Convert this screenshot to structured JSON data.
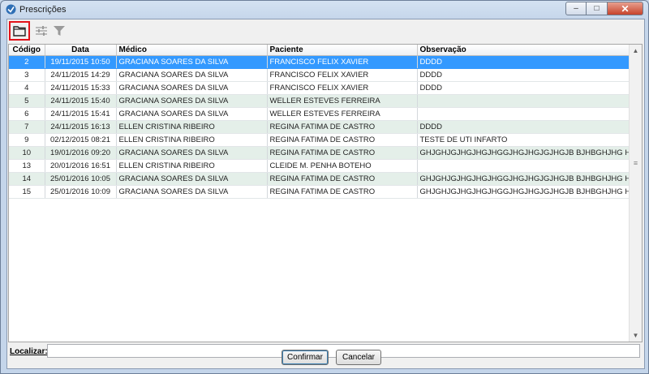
{
  "window": {
    "title": "Prescrições",
    "minimize_glyph": "–",
    "maximize_glyph": "□",
    "close_glyph": "✕"
  },
  "toolbar": {
    "icons": [
      "folder-open-icon",
      "columns-settings-icon",
      "filter-icon"
    ],
    "highlight_color": "#e2131a"
  },
  "table": {
    "columns": [
      "Código",
      "Data",
      "Médico",
      "Paciente",
      "Observação"
    ],
    "rows": [
      {
        "codigo": "2",
        "data": "19/11/2015 10:50",
        "medico": "GRACIANA SOARES DA SILVA",
        "paciente": "FRANCISCO FELIX XAVIER",
        "observacao": "DDDD"
      },
      {
        "codigo": "3",
        "data": "24/11/2015 14:29",
        "medico": "GRACIANA SOARES DA SILVA",
        "paciente": "FRANCISCO FELIX XAVIER",
        "observacao": "DDDD"
      },
      {
        "codigo": "4",
        "data": "24/11/2015 15:33",
        "medico": "GRACIANA SOARES DA SILVA",
        "paciente": "FRANCISCO FELIX XAVIER",
        "observacao": "DDDD"
      },
      {
        "codigo": "5",
        "data": "24/11/2015 15:40",
        "medico": "GRACIANA SOARES DA SILVA",
        "paciente": "WELLER ESTEVES FERREIRA",
        "observacao": ""
      },
      {
        "codigo": "6",
        "data": "24/11/2015 15:41",
        "medico": "GRACIANA SOARES DA SILVA",
        "paciente": "WELLER ESTEVES FERREIRA",
        "observacao": ""
      },
      {
        "codigo": "7",
        "data": "24/11/2015 16:13",
        "medico": "ELLEN CRISTINA RIBEIRO",
        "paciente": "REGINA FATIMA DE CASTRO",
        "observacao": "DDDD"
      },
      {
        "codigo": "9",
        "data": "02/12/2015 08:21",
        "medico": "ELLEN CRISTINA RIBEIRO",
        "paciente": "REGINA FATIMA DE CASTRO",
        "observacao": "TESTE DE UTI INFARTO"
      },
      {
        "codigo": "10",
        "data": "19/01/2016 09:20",
        "medico": "GRACIANA SOARES DA SILVA",
        "paciente": "REGINA FATIMA DE CASTRO",
        "observacao": "GHJGHJGJHGJHGJHGGJHGJHGJGJHGJB BJHBGHJHG   HGHHG HJG"
      },
      {
        "codigo": "13",
        "data": "20/01/2016 16:51",
        "medico": "ELLEN CRISTINA RIBEIRO",
        "paciente": "CLEIDE M. PENHA BOTEHO",
        "observacao": ""
      },
      {
        "codigo": "14",
        "data": "25/01/2016 10:05",
        "medico": "GRACIANA SOARES DA SILVA",
        "paciente": "REGINA FATIMA DE CASTRO",
        "observacao": "GHJGHJGJHGJHGJHGGJHGJHGJGJHGJB BJHBGHJHG   HGHHG HJG"
      },
      {
        "codigo": "15",
        "data": "25/01/2016 10:09",
        "medico": "GRACIANA SOARES DA SILVA",
        "paciente": "REGINA FATIMA DE CASTRO",
        "observacao": "GHJGHJGJHGJHGJHGGJHGJHGJGJHGJB BJHBGHJHG   HGHHG HJG"
      }
    ],
    "selected_row_index": 0,
    "selection_color": "#3399ff",
    "alt_row_color": "#e4efe9"
  },
  "search": {
    "label": "Localizar:",
    "value": ""
  },
  "footer": {
    "confirm_label": "Confirmar",
    "cancel_label": "Cancelar"
  }
}
